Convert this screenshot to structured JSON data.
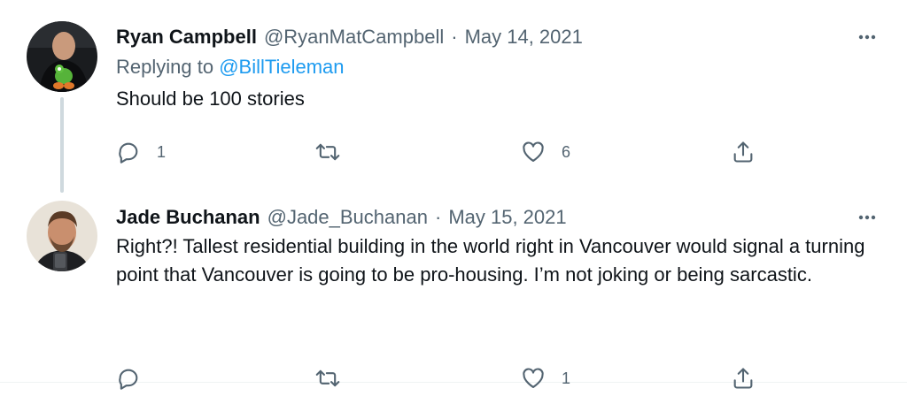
{
  "tweets": [
    {
      "author_name": "Ryan Campbell",
      "handle": "@RyanMatCampbell",
      "separator": "·",
      "date": "May 14, 2021",
      "replying_prefix": "Replying to ",
      "replying_to": "@BillTieleman",
      "text": "Should be 100 stories",
      "reply_count": "1",
      "retweet_count": "",
      "like_count": "6"
    },
    {
      "author_name": "Jade Buchanan",
      "handle": "@Jade_Buchanan",
      "separator": "·",
      "date": "May 15, 2021",
      "text": "Right?! Tallest residential building in the world right in Vancouver would signal a turning point that Vancouver is going to be pro-housing. I’m not joking or being sarcastic.",
      "reply_count": "",
      "retweet_count": "",
      "like_count": "1"
    }
  ],
  "icons": {
    "more": "more-icon",
    "reply": "reply-icon",
    "retweet": "retweet-icon",
    "like": "like-icon",
    "share": "share-icon"
  },
  "colors": {
    "text": "#0f1419",
    "secondary": "#536471",
    "link": "#1d9bf0",
    "thread_line": "#cfd9de"
  }
}
